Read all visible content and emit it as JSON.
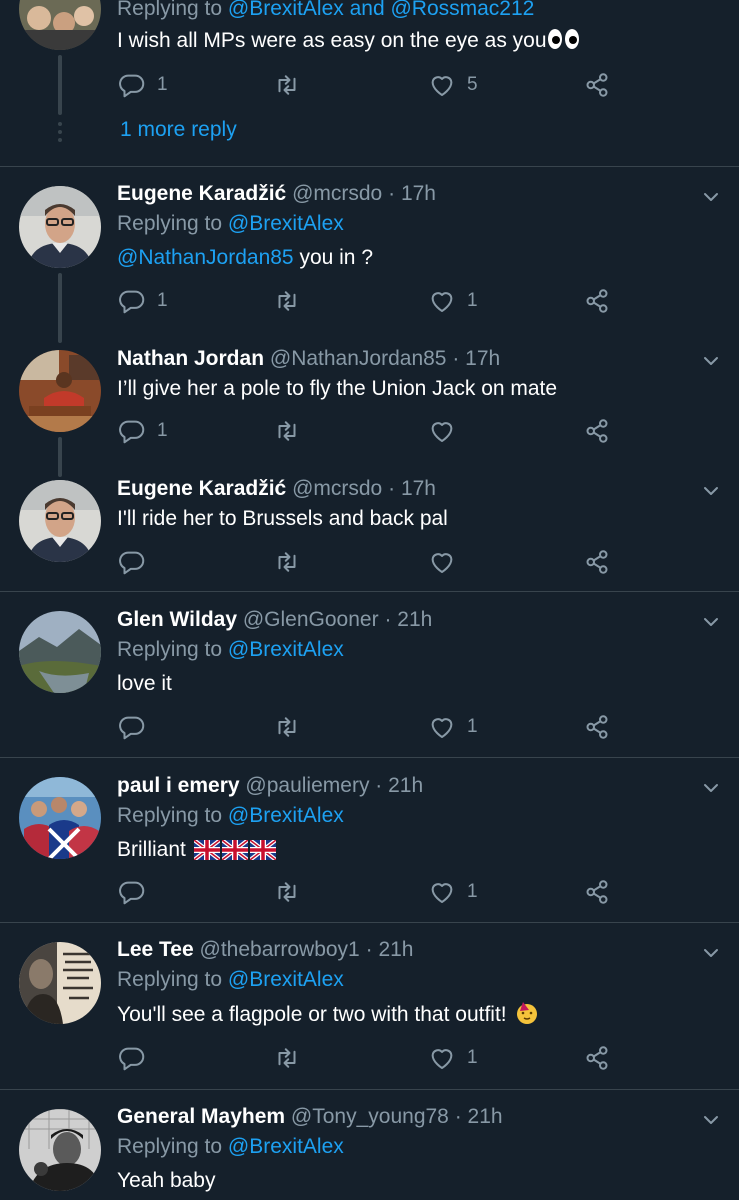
{
  "top_partial": {
    "replying_prefix": "Replying to",
    "replying_to": "@BrexitAlex and @Rossmac212",
    "text": "I wish all MPs were as easy on the eye as you",
    "reply_count": "1",
    "like_count": "5",
    "more_replies": "1 more reply"
  },
  "tweets": [
    {
      "name": "Eugene Karadžić",
      "handle": "@mcrsdo",
      "time": "17h",
      "replying_prefix": "Replying to",
      "replying_to": "@BrexitAlex",
      "mention": "@NathanJordan85",
      "text": " you in ?",
      "reply_count": "1",
      "like_count": "1"
    },
    {
      "name": "Nathan Jordan",
      "handle": "@NathanJordan85",
      "time": "17h",
      "text": "I’ll give her a pole to fly the Union Jack on mate",
      "reply_count": "1",
      "like_count": ""
    },
    {
      "name": "Eugene Karadžić",
      "handle": "@mcrsdo",
      "time": "17h",
      "text": "I'll ride her to Brussels and back pal",
      "reply_count": "",
      "like_count": ""
    },
    {
      "name": "Glen Wilday",
      "handle": "@GlenGooner",
      "time": "21h",
      "replying_prefix": "Replying to",
      "replying_to": "@BrexitAlex",
      "text": "love it",
      "reply_count": "",
      "like_count": "1"
    },
    {
      "name": "paul i emery",
      "handle": "@pauliemery",
      "time": "21h",
      "replying_prefix": "Replying to",
      "replying_to": "@BrexitAlex",
      "text": "Brilliant ",
      "reply_count": "",
      "like_count": "1"
    },
    {
      "name": "Lee Tee",
      "handle": "@thebarrowboy1",
      "time": "21h",
      "replying_prefix": "Replying to",
      "replying_to": "@BrexitAlex",
      "text": "You'll see a flagpole or two with that outfit! ",
      "reply_count": "",
      "like_count": "1"
    },
    {
      "name": "General Mayhem",
      "handle": "@Tony_young78",
      "time": "21h",
      "replying_prefix": "Replying to",
      "replying_to": "@BrexitAlex",
      "text": "Yeah baby",
      "reply_count": "",
      "like_count": ""
    }
  ],
  "dot_separator": "·",
  "colors": {
    "background": "#15202b",
    "divider": "#38444d",
    "link": "#1da1f2",
    "secondary_text": "#8899a6"
  },
  "icons": [
    "reply-icon",
    "retweet-icon",
    "like-icon",
    "share-icon",
    "chevron-down-icon"
  ]
}
